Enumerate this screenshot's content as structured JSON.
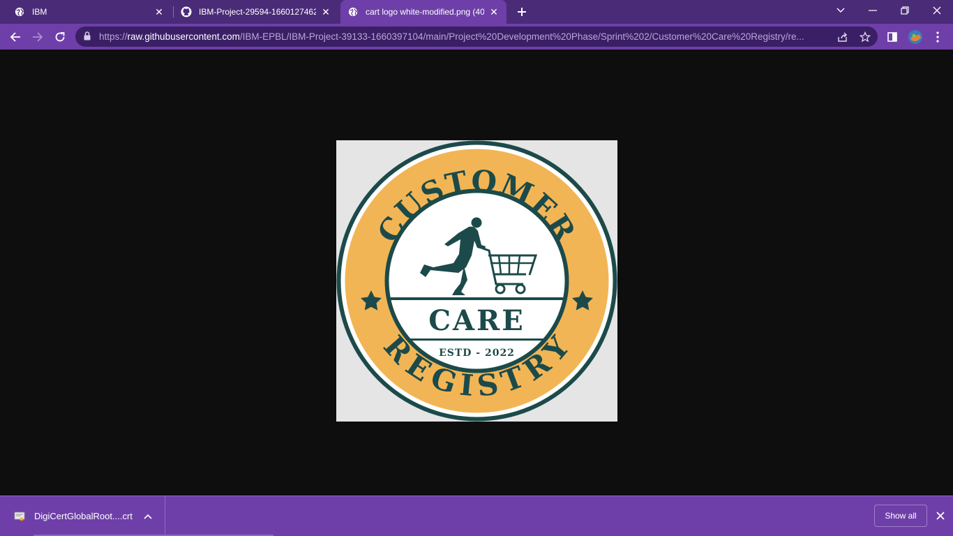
{
  "tabs": [
    {
      "title": "IBM",
      "icon": "globe-icon",
      "active": false
    },
    {
      "title": "IBM-Project-29594-1660127462/P",
      "icon": "github-icon",
      "active": false
    },
    {
      "title": "cart logo white-modified.png (40",
      "icon": "globe-icon",
      "active": true
    }
  ],
  "address_bar": {
    "url_prefix": "https://",
    "url_host": "raw.githubusercontent.com",
    "url_path": "/IBM-EPBL/IBM-Project-39133-1660397104/main/Project%20Development%20Phase/Sprint%202/Customer%20Care%20Registry/re..."
  },
  "logo": {
    "top_text": "CUSTOMER",
    "center_text": "CARE",
    "estd_text": "ESTD - 2022",
    "bottom_text": "REGISTRY",
    "colors": {
      "dark": "#1c4a4a",
      "gold": "#f2b555",
      "white": "#ffffff",
      "background": "#e5e5e5"
    }
  },
  "downloads": {
    "file_name": "DigiCertGlobalRoot....crt",
    "show_all_label": "Show all"
  },
  "colors": {
    "frame": "#4a2b78",
    "toolbar": "#6e3fa8",
    "viewport": "#0e0e0e"
  }
}
